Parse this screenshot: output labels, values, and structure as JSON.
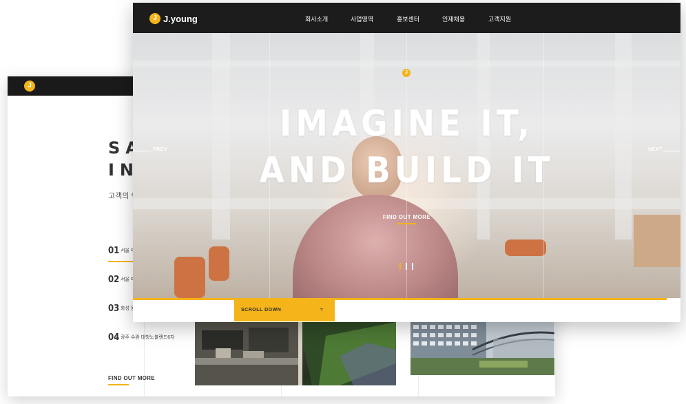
{
  "back_window": {
    "title_line1": "SAL",
    "title_line2": "INF",
    "subtitle": "고객의 행",
    "sites": [
      {
        "num": "01",
        "label": "서울 마"
      },
      {
        "num": "02",
        "label": "서울 마"
      },
      {
        "num": "03",
        "label": "화성 동"
      },
      {
        "num": "04",
        "label": "광주 수완 대방노블랜드6차"
      }
    ],
    "find_out_more": "FIND OUT MORE"
  },
  "front_window": {
    "logo_mark": "J",
    "logo_text": "J.young",
    "nav": [
      "회사소개",
      "사업영역",
      "홍보센터",
      "인재채용",
      "고객지원"
    ],
    "hero": {
      "line1": "IMAGINE IT,",
      "line2": "AND BUILD IT",
      "find_out_more": "FIND OUT MORE",
      "prev": "PREV",
      "next": "NEXT"
    },
    "scroll_down": "SCROLL DOWN",
    "scroll_icon": "triangle-down-icon"
  },
  "colors": {
    "accent": "#f4b41a",
    "nav_bg": "#1c1c1c"
  }
}
